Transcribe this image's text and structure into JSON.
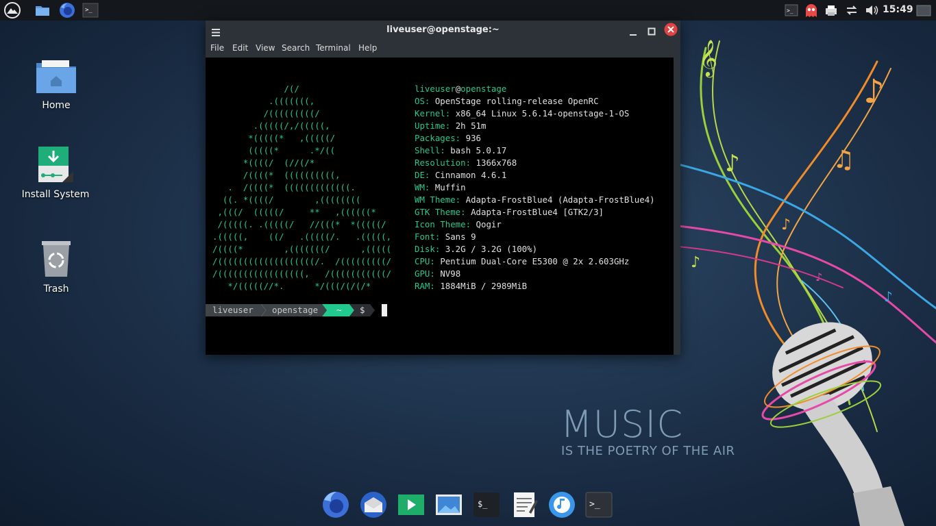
{
  "top_panel": {
    "clock": "15:49",
    "icons": [
      "menu-logo-icon",
      "file-manager-icon",
      "firefox-icon",
      "terminal-icon"
    ],
    "tray": [
      "terminal-icon",
      "ghost-icon",
      "printer-icon",
      "network-icon",
      "volume-icon",
      "workspace-icon"
    ]
  },
  "desktop": {
    "icons": [
      {
        "label": "Home"
      },
      {
        "label": "Install System"
      },
      {
        "label": "Trash"
      }
    ]
  },
  "wallpaper": {
    "title": "MUSIC",
    "subtitle": "IS THE POETRY OF THE AIR"
  },
  "terminal": {
    "title": "liveuser@openstage:~",
    "menu": [
      "File",
      "Edit",
      "View",
      "Search",
      "Terminal",
      "Help"
    ],
    "ascii_art": [
      "              /(/",
      "           .(((((((,",
      "          /(((((((((/",
      "        .(((((/,/(((((,",
      "       *(((((*   ,(((((/",
      "       (((((*      .*/((",
      "      *((((/  (//(/*",
      "      /((((*  ((((((((((,",
      "   .  /((((*  (((((((((((((.",
      "  ((. *((((/        ,((((((((",
      " ,(((/  (((((/     **   ,((((((*",
      " /(((((. .(((((/   //(((*  *(((((/",
      ".(((((,    ((/   .(((((/.   .(((((,",
      "/((((*        ,(((((((/      ,(((((",
      "/(((((((((((((((((((/.  /(((((((((/",
      "/(((((((((((((((((,   /(((((((((((/",
      "   */(((((//*.      */(((/(/(/*"
    ],
    "header_user": "liveuser",
    "header_at": "@",
    "header_host": "openstage",
    "info": [
      {
        "k": "OS: ",
        "v": "OpenStage rolling-release OpenRC"
      },
      {
        "k": "Kernel: ",
        "v": "x86_64 Linux 5.6.14-openstage-1-OS"
      },
      {
        "k": "Uptime: ",
        "v": "2h 51m"
      },
      {
        "k": "Packages: ",
        "v": "936"
      },
      {
        "k": "Shell: ",
        "v": "bash 5.0.17"
      },
      {
        "k": "Resolution: ",
        "v": "1366x768"
      },
      {
        "k": "DE: ",
        "v": "Cinnamon 4.6.1"
      },
      {
        "k": "WM: ",
        "v": "Muffin"
      },
      {
        "k": "WM Theme: ",
        "v": "Adapta-FrostBlue4 (Adapta-FrostBlue4)"
      },
      {
        "k": "GTK Theme: ",
        "v": "Adapta-FrostBlue4 [GTK2/3]"
      },
      {
        "k": "Icon Theme: ",
        "v": "Qogir"
      },
      {
        "k": "Font: ",
        "v": "Sans 9"
      },
      {
        "k": "Disk: ",
        "v": "3.2G / 3.2G (100%)"
      },
      {
        "k": "CPU: ",
        "v": "Pentium Dual-Core E5300 @ 2x 2.603GHz"
      },
      {
        "k": "GPU: ",
        "v": "NV98"
      },
      {
        "k": "RAM: ",
        "v": "1884MiB / 2989MiB"
      }
    ],
    "prompt": {
      "user": "liveuser",
      "host": "openstage",
      "dir": "~",
      "symbol": "$"
    }
  },
  "dock": [
    "firefox-icon",
    "thunderbird-icon",
    "media-player-icon",
    "image-viewer-icon",
    "terminal-app-icon",
    "text-editor-icon",
    "music-player-icon",
    "terminal-icon"
  ],
  "colors": {
    "accent": "#22c98f",
    "panel": "#14181d",
    "titlebar": "#2d3238",
    "close": "#e04343"
  }
}
